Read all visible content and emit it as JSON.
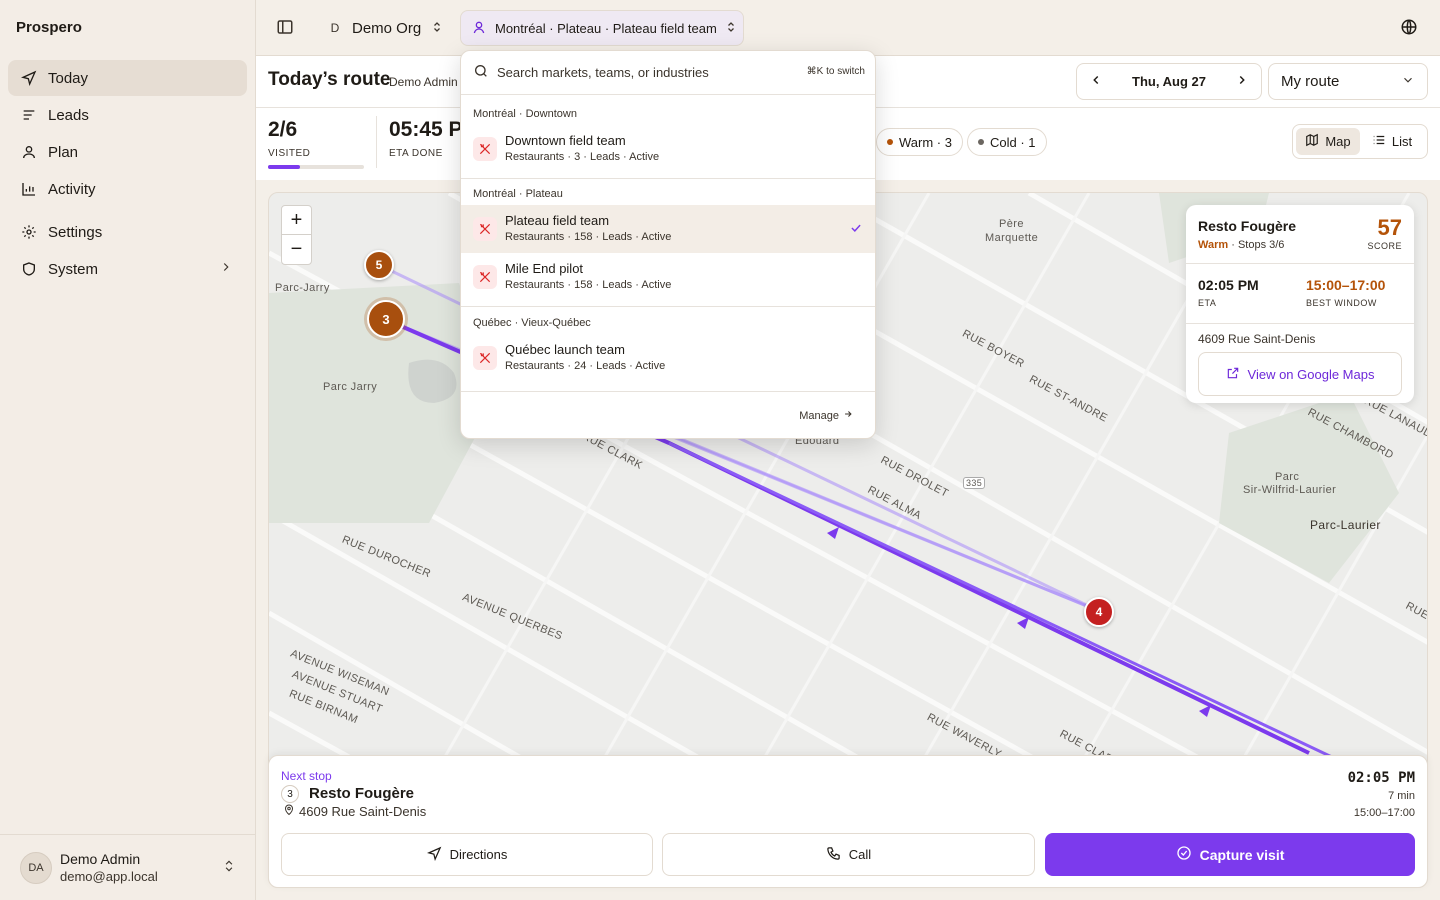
{
  "app": {
    "brand": "Prospero"
  },
  "sidebar": {
    "items": [
      {
        "label": "Today",
        "icon": "send-icon"
      },
      {
        "label": "Leads",
        "icon": "list-icon"
      },
      {
        "label": "Plan",
        "icon": "user-icon"
      },
      {
        "label": "Activity",
        "icon": "bar-chart-icon"
      },
      {
        "label": "Settings",
        "icon": "gear-icon"
      },
      {
        "label": "System",
        "icon": "shield-icon"
      }
    ],
    "user": {
      "initials": "DA",
      "name": "Demo Admin",
      "email": "demo@app.local"
    }
  },
  "topbar": {
    "org_letter": "D",
    "org_name": "Demo Org",
    "team_switch": "Montréal · Plateau · Plateau field team"
  },
  "header": {
    "title": "Today’s route",
    "subtitle": "Demo Admin",
    "date": "Thu, Aug 27",
    "route_select": "My route"
  },
  "stats": {
    "visited_value": "2/6",
    "visited_label": "VISITED",
    "visited_progress": 0.33,
    "eta_value": "05:45 P",
    "eta_label": "ETA DONE",
    "warm_label": "Warm · 3",
    "cold_label": "Cold · 1",
    "colors": {
      "warm": "#b45309",
      "cold": "#6b6660",
      "accent": "#7c3aed"
    }
  },
  "view_toggle": {
    "map": "Map",
    "list": "List",
    "active": "map"
  },
  "dropdown": {
    "search_placeholder": "Search markets, teams, or industries",
    "kbd_hint": "⌘K to switch",
    "groups": [
      {
        "title": "Montréal · Downtown",
        "items": [
          {
            "title": "Downtown field team",
            "sub": "Restaurants · 3 · Leads · Active"
          }
        ]
      },
      {
        "title": "Montréal · Plateau",
        "items": [
          {
            "title": "Plateau field team",
            "sub": "Restaurants · 158 · Leads · Active",
            "selected": true
          },
          {
            "title": "Mile End pilot",
            "sub": "Restaurants · 158 · Leads · Active"
          }
        ]
      },
      {
        "title": "Québec · Vieux-Québec",
        "items": [
          {
            "title": "Québec launch team",
            "sub": "Restaurants · 24 · Leads · Active"
          }
        ]
      }
    ],
    "manage": "Manage"
  },
  "map": {
    "zoom_in": "+",
    "zoom_out": "−",
    "labels": {
      "parc_jarry_area": "Parc-Jarry",
      "parc_jarry": "Parc Jarry",
      "pere_marquette_1": "Père",
      "pere_marquette_2": "Marquette",
      "rue_boyer": "RUE BOYER",
      "rue_st_andre": "RUE ST-ANDRE",
      "rue_lanaudiere": "RUE LANAUDIERE",
      "rue_chambord": "RUE CHAMBORD",
      "rue_clark": "RUE CLARK",
      "edouard": "Édouard",
      "rue_drolet": "RUE DROLET",
      "rue_alma": "RUE ALMA",
      "route_335": "335",
      "parc_sir_1": "Parc",
      "parc_sir_2": "Sir-Wilfrid-Laurier",
      "parc_laurier": "Parc-Laurier",
      "rue_durocher": "RUE DUROCHER",
      "avenue_querbes": "AVENUE QUERBES",
      "avenue_wiseman": "AVENUE WISEMAN",
      "avenue_stuart": "AVENUE STUART",
      "rue_birnam": "RUE BIRNAM",
      "rue_waverly": "RUE WAVERLY",
      "rue_clark_2": "RUE CLAR",
      "rue_edge": "RUE"
    },
    "markers": [
      {
        "num": "5",
        "color": "#a84f0e"
      },
      {
        "num": "3",
        "color": "#a84f0e"
      },
      {
        "num": "4",
        "color": "#c42020"
      }
    ]
  },
  "stop_card": {
    "name": "Resto Fougère",
    "status": "Warm",
    "stops": "Stops 3/6",
    "score": "57",
    "score_label": "SCORE",
    "eta": "02:05 PM",
    "eta_label": "ETA",
    "window": "15:00–17:00",
    "window_label": "BEST WINDOW",
    "address": "4609 Rue Saint-Denis",
    "gmaps_button": "View on Google Maps"
  },
  "next_stop": {
    "label": "Next stop",
    "num": "3",
    "name": "Resto Fougère",
    "address": "4609 Rue Saint-Denis",
    "time": "02:05 PM",
    "duration": "7 min",
    "window": "15:00–17:00",
    "directions": "Directions",
    "call": "Call",
    "capture": "Capture visit"
  }
}
